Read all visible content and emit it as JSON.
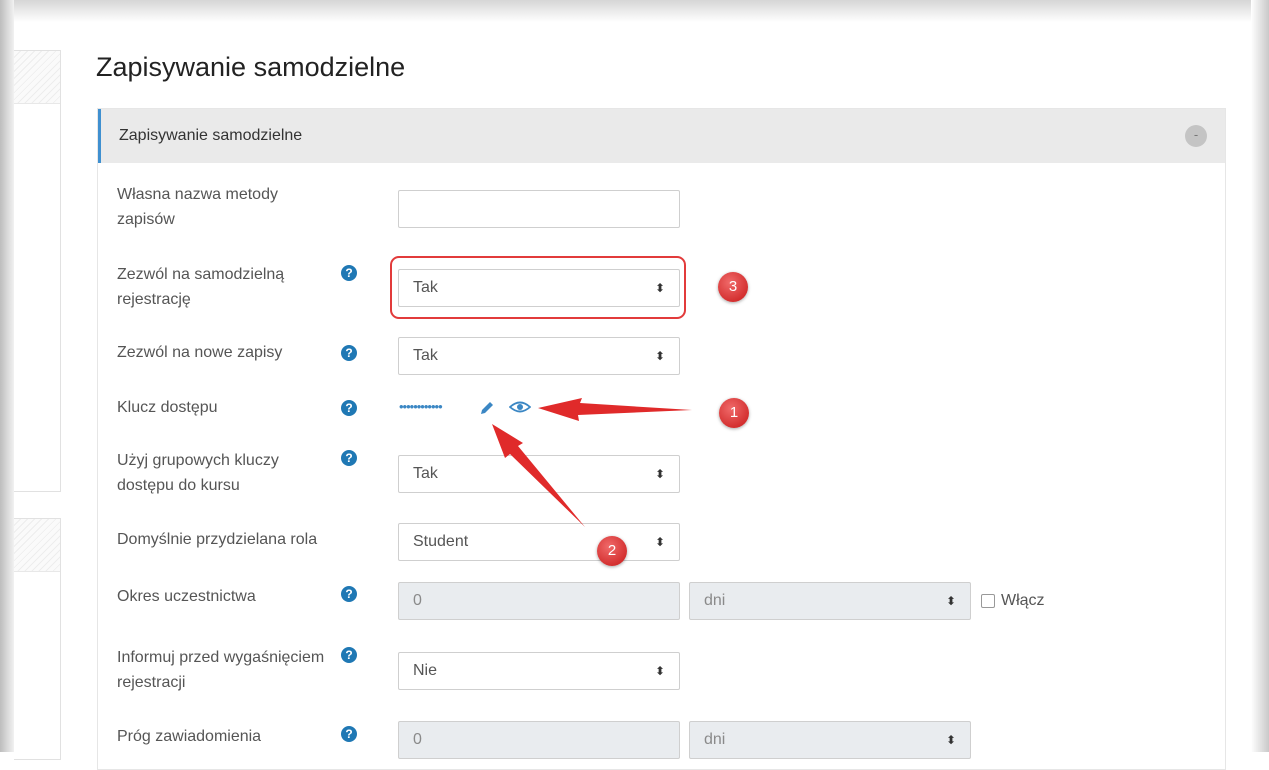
{
  "page_title": "Zapisywanie samodzielne",
  "section": {
    "header": "Zapisywanie samodzielne",
    "collapse_symbol": "-"
  },
  "fields": {
    "name": {
      "label": "Własna nazwa metody zapisów",
      "value": ""
    },
    "allow_self": {
      "label": "Zezwól na samodzielną rejestrację",
      "value": "Tak"
    },
    "allow_new": {
      "label": "Zezwól na nowe zapisy",
      "value": "Tak"
    },
    "key": {
      "label": "Klucz dostępu",
      "masked": "••••••••••••"
    },
    "group_keys": {
      "label": "Użyj grupowych kluczy dostępu do kursu",
      "value": "Tak"
    },
    "default_role": {
      "label": "Domyślnie przydzielana rola",
      "value": "Student"
    },
    "period": {
      "label": "Okres uczestnictwa",
      "value": "0",
      "unit": "dni",
      "enable_label": "Włącz"
    },
    "notify": {
      "label": "Informuj przed wygaśnięciem rejestracji",
      "value": "Nie"
    },
    "threshold": {
      "label": "Próg zawiadomienia",
      "value": "0",
      "unit": "dni"
    }
  },
  "help_icon_symbol": "?",
  "select_arrow_symbol": "⬍",
  "annotations": {
    "badge1": "1",
    "badge2": "2",
    "badge3": "3",
    "color": "#e23b3b"
  },
  "colors": {
    "accent": "#3f90d0",
    "help": "#1f78b4",
    "link": "#3b87c4"
  }
}
